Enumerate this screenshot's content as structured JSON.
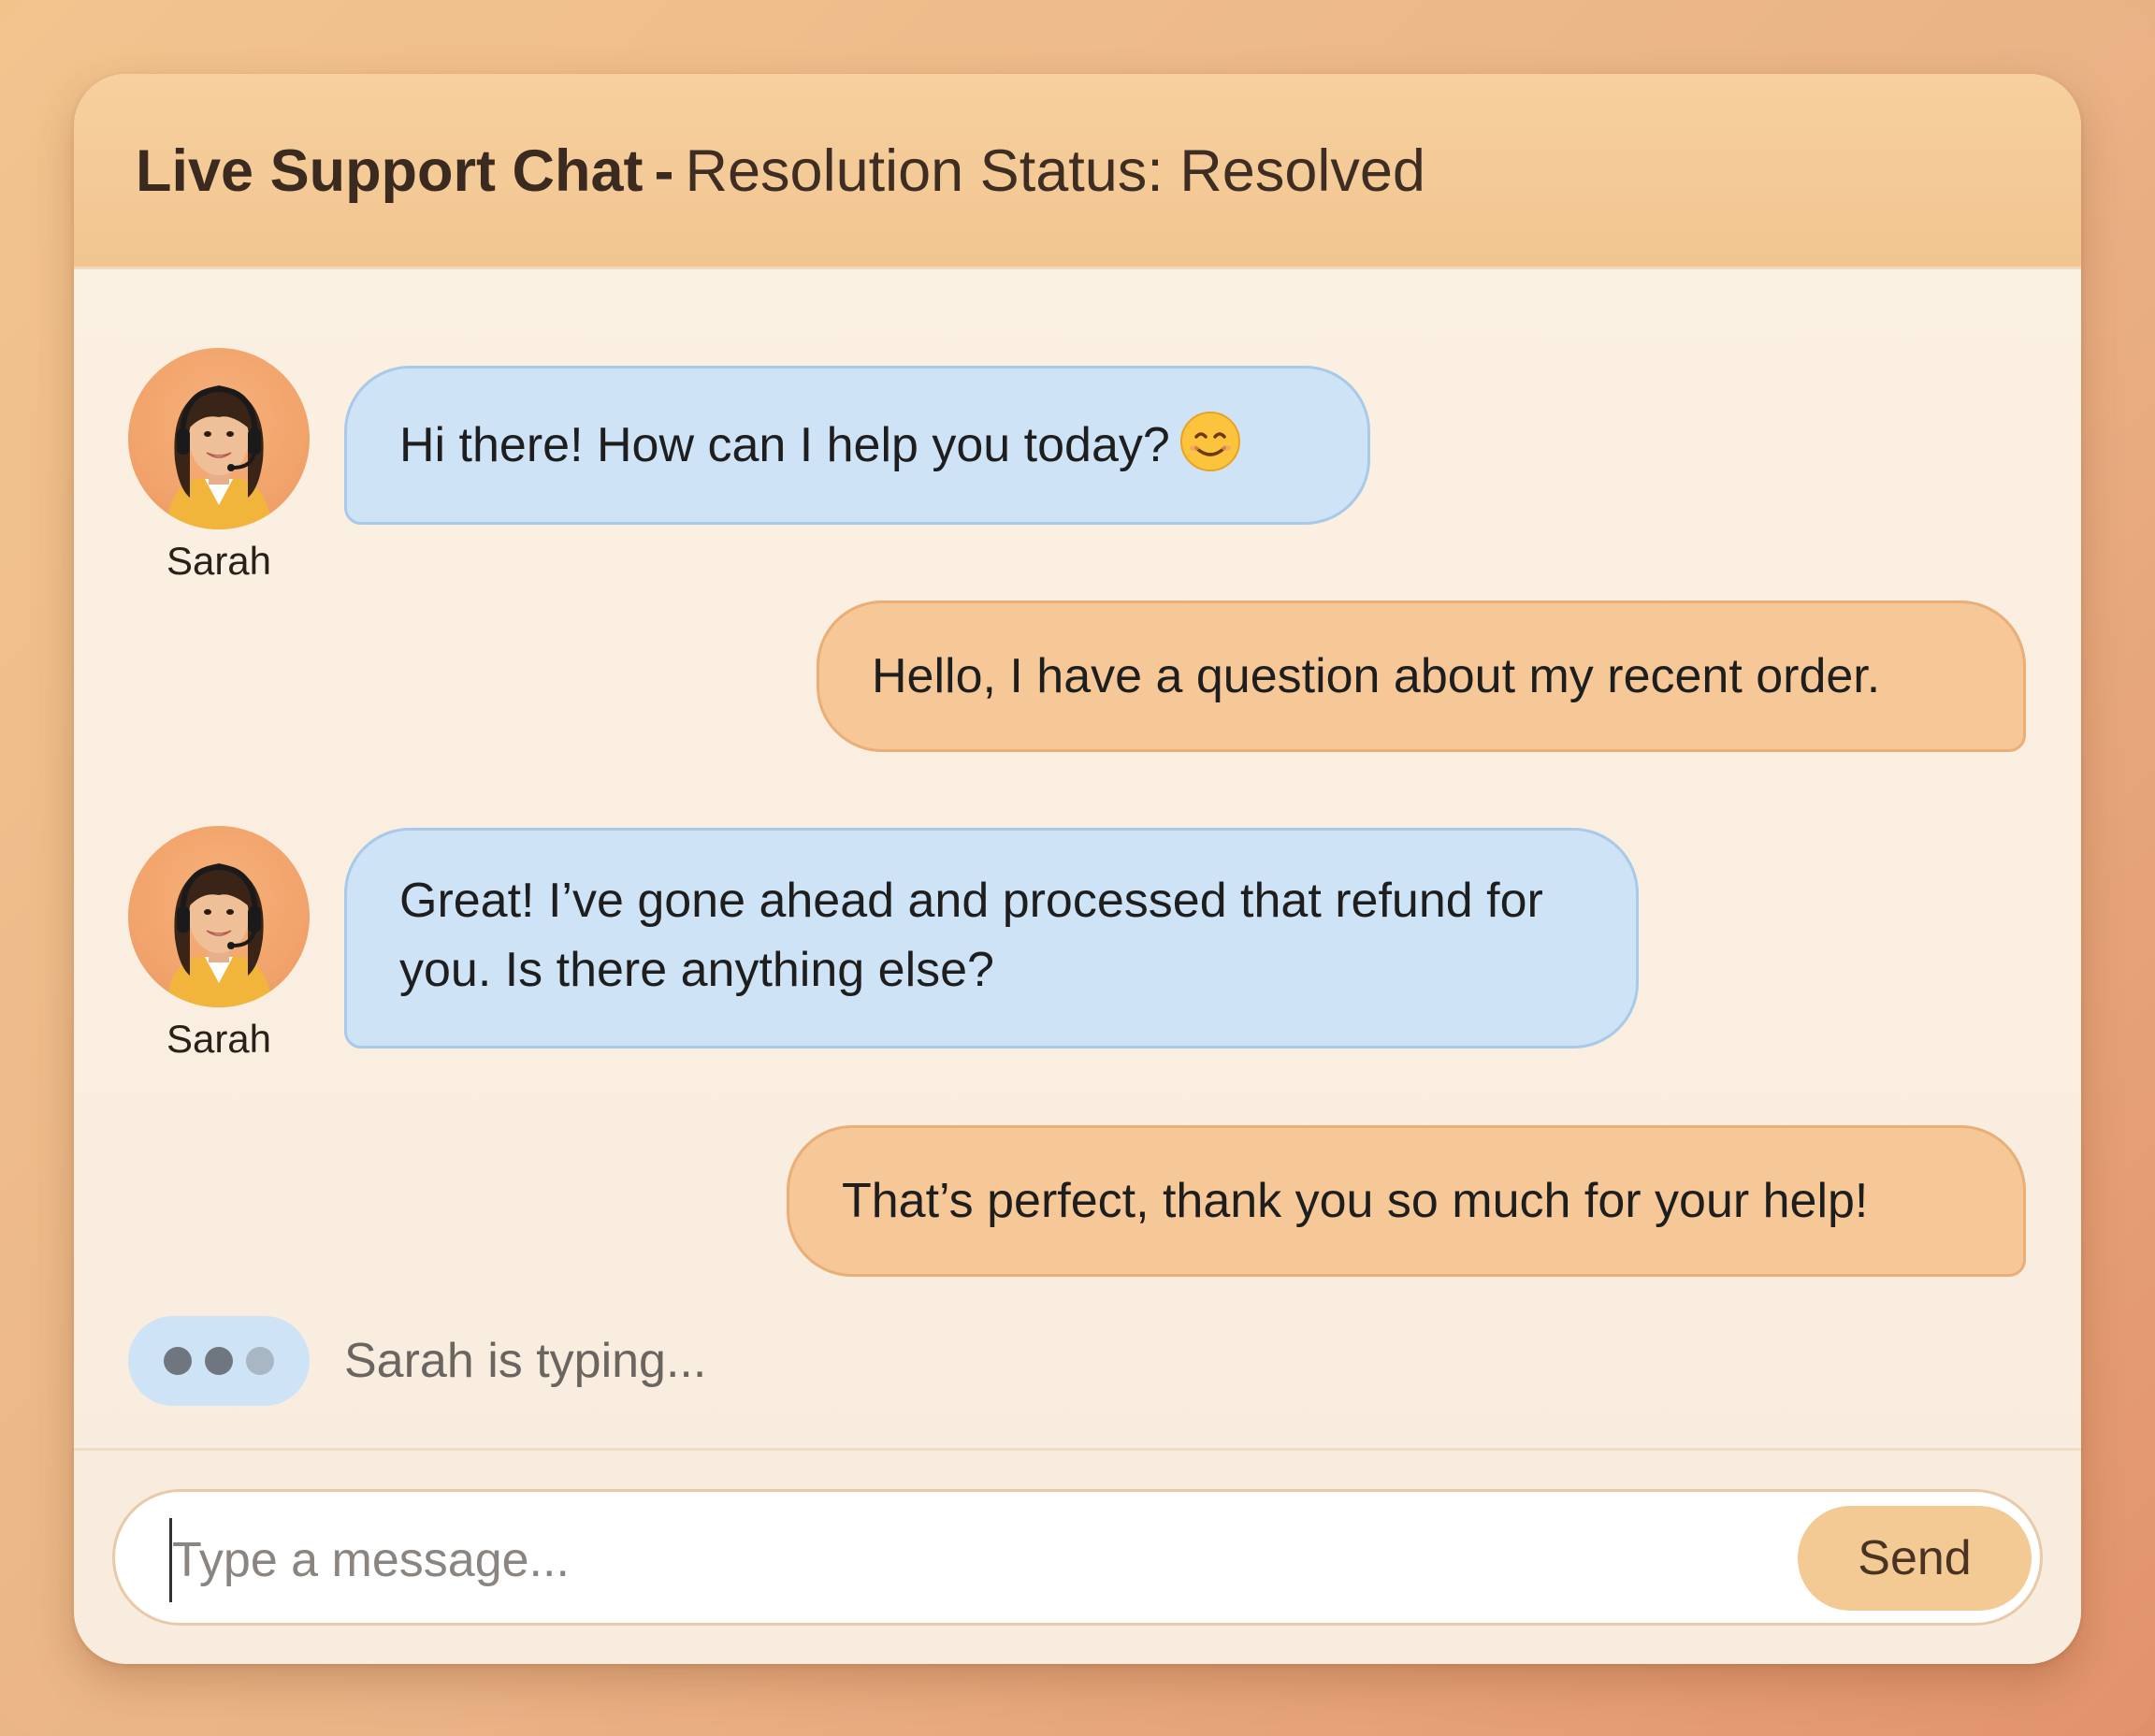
{
  "header": {
    "title": "Live Support Chat",
    "separator": "-",
    "status_text": "Resolution Status: Resolved"
  },
  "messages": [
    {
      "sender": "agent",
      "name": "Sarah",
      "text": "Hi there! How can I help you today?",
      "emoji": "smiling-face-icon"
    },
    {
      "sender": "user",
      "text": "Hello, I have a question about my recent order."
    },
    {
      "sender": "agent",
      "name": "Sarah",
      "text": "Great! I’ve gone ahead and processed that refund for you. Is there anything else?"
    },
    {
      "sender": "user",
      "text": "That’s perfect, thank you so much for your help!"
    }
  ],
  "typing": {
    "text": "Sarah is typing..."
  },
  "composer": {
    "placeholder": "Type a message...",
    "send_label": "Send"
  },
  "colors": {
    "agent_bubble": "#cfe3f7",
    "user_bubble": "#f6c898",
    "header_bg": "#f4cb97",
    "send_button": "#f3c994"
  }
}
